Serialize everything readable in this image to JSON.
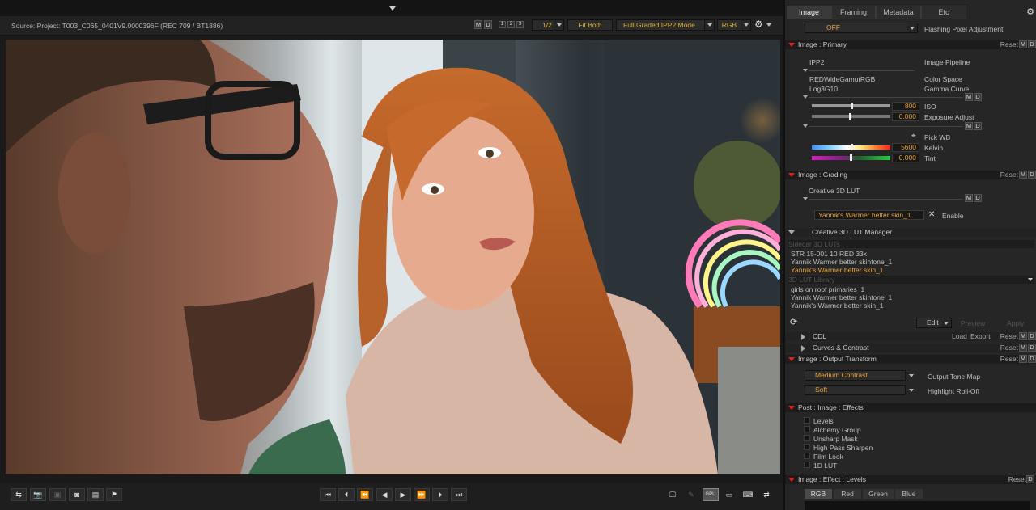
{
  "viewer": {
    "source": "Source: Project: T003_C065_0401V9.0000396F   (REC 709 / BT1886)",
    "m": "M",
    "d": "D",
    "n1": "1",
    "n2": "2",
    "n3": "3",
    "res": "1/2",
    "fit": "Fit Both",
    "mode": "Full Graded IPP2 Mode",
    "chan": "RGB"
  },
  "transport": {
    "first": "⏮",
    "prev_clip": "⏪",
    "step_back": "◀◀",
    "rev": "◀",
    "play": "▶",
    "ff": "▶▶",
    "next_clip": "⏩",
    "last": "⏭"
  },
  "tabs": [
    "Image",
    "Framing",
    "Metadata",
    "Etc"
  ],
  "flash": {
    "value": "OFF",
    "label": "Flashing Pixel Adjustment"
  },
  "primary": {
    "title": "Image : Primary",
    "reset": "Reset",
    "pipeline_val": "IPP2",
    "pipeline_lbl": "Image Pipeline",
    "cs_val": "REDWideGamutRGB",
    "cs_lbl": "Color Space",
    "gc_val": "Log3G10",
    "gc_lbl": "Gamma Curve",
    "iso": "800",
    "iso_lbl": "ISO",
    "exp": "0.000",
    "exp_lbl": "Exposure Adjust",
    "pickwb": "Pick WB",
    "kelvin": "5600",
    "kelvin_lbl": "Kelvin",
    "tint": "0.000",
    "tint_lbl": "Tint"
  },
  "grading": {
    "title": "Image : Grading",
    "reset": "Reset",
    "lut_lbl": "Creative 3D LUT",
    "lut_val": "Yannik's Warmer better skin_1",
    "x": "✕",
    "enable": "Enable"
  },
  "lutmgr": {
    "title": "Creative 3D LUT Manager",
    "sidecar": "Sidecar 3D LUTs",
    "sidecar_items": [
      "STR 15-001 10 RED 33x",
      "Yannik Warmer better skintone_1",
      "Yannik's Warmer better skin_1"
    ],
    "library": "3D LUT Library",
    "library_items": [
      "girls on roof primaries_1",
      "Yannik Warmer better skintone_1",
      "Yannik's Warmer better skin_1"
    ],
    "edit": "Edit",
    "preview": "Preview",
    "apply": "Apply"
  },
  "cdl": {
    "title": "CDL",
    "load": "Load",
    "export": "Export",
    "reset": "Reset"
  },
  "curves": {
    "title": "Curves & Contrast",
    "reset": "Reset"
  },
  "output": {
    "title": "Image : Output Transform",
    "reset": "Reset",
    "tone_val": "Medium Contrast",
    "tone_lbl": "Output Tone Map",
    "roll_val": "Soft",
    "roll_lbl": "Highlight Roll-Off"
  },
  "effects": {
    "title": "Post : Image : Effects",
    "items": [
      "Levels",
      "Alchemy Group",
      "Unsharp Mask",
      "High Pass Sharpen",
      "Film Look",
      "1D LUT"
    ]
  },
  "levels": {
    "title": "Image : Effect : Levels",
    "reset": "Reset",
    "tabs": [
      "RGB",
      "Red",
      "Green",
      "Blue"
    ]
  }
}
